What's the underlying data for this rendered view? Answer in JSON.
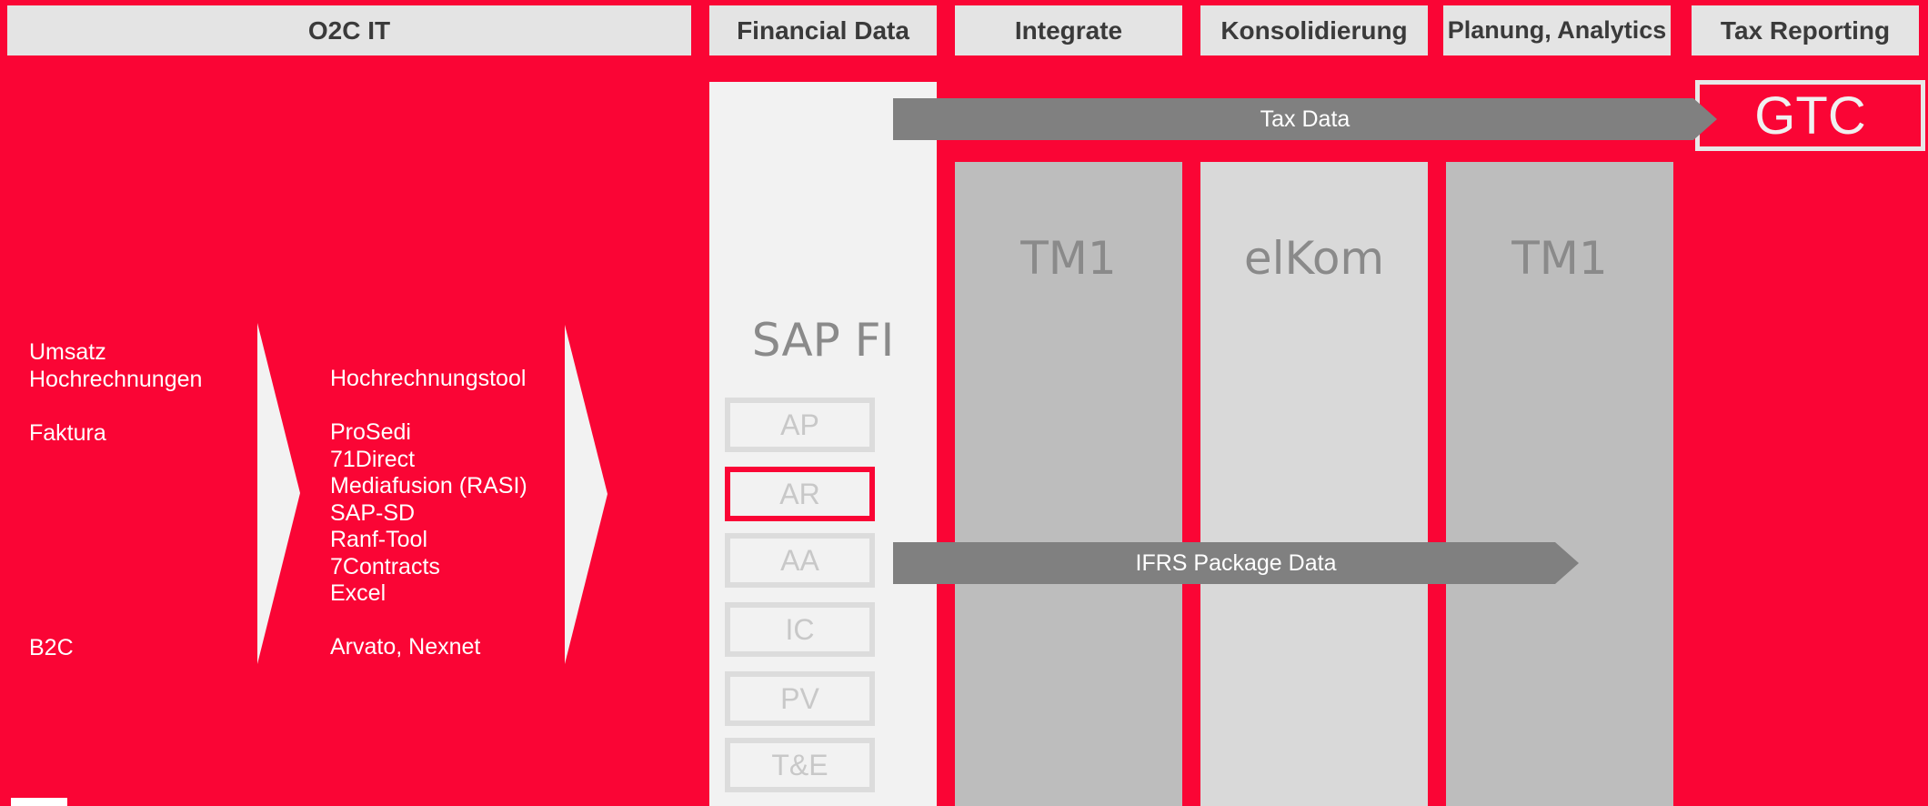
{
  "headers": {
    "o2c": "O2C IT",
    "financial": "Financial Data",
    "integrate": "Integrate",
    "konsolidierung": "Konsolidierung",
    "planung": "Planung, Analytics",
    "tax": "Tax Reporting"
  },
  "columns": {
    "sap": "SAP FI",
    "tm1_integrate": "TM1",
    "elkom": "elKom",
    "tm1_planung": "TM1"
  },
  "gtc": "GTC",
  "arrows": {
    "tax_data": "Tax Data",
    "ifrs": "IFRS Package Data"
  },
  "left_list": {
    "l1": "Umsatz",
    "l2": "Hochrechnungen",
    "l3": "Faktura",
    "l4": "B2C"
  },
  "tools_list": {
    "t1": "Hochrechnungstool",
    "t2": "ProSedi",
    "t3": "71Direct",
    "t4": "Mediafusion (RASI)",
    "t5": "SAP-SD",
    "t6": "Ranf-Tool",
    "t7": "7Contracts",
    "t8": "Excel",
    "t9": "Arvato, Nexnet"
  },
  "modules": [
    "AP",
    "AR",
    "AA",
    "IC",
    "PV",
    "T&E"
  ],
  "highlighted_module": "AR",
  "colors": {
    "background": "#FA0535",
    "header_bg": "#E4E4E4",
    "sap_column": "#F2F2F2",
    "tm1_column": "#BDBDBD",
    "elkom_column": "#D9D9D9",
    "arrow": "#808080"
  }
}
